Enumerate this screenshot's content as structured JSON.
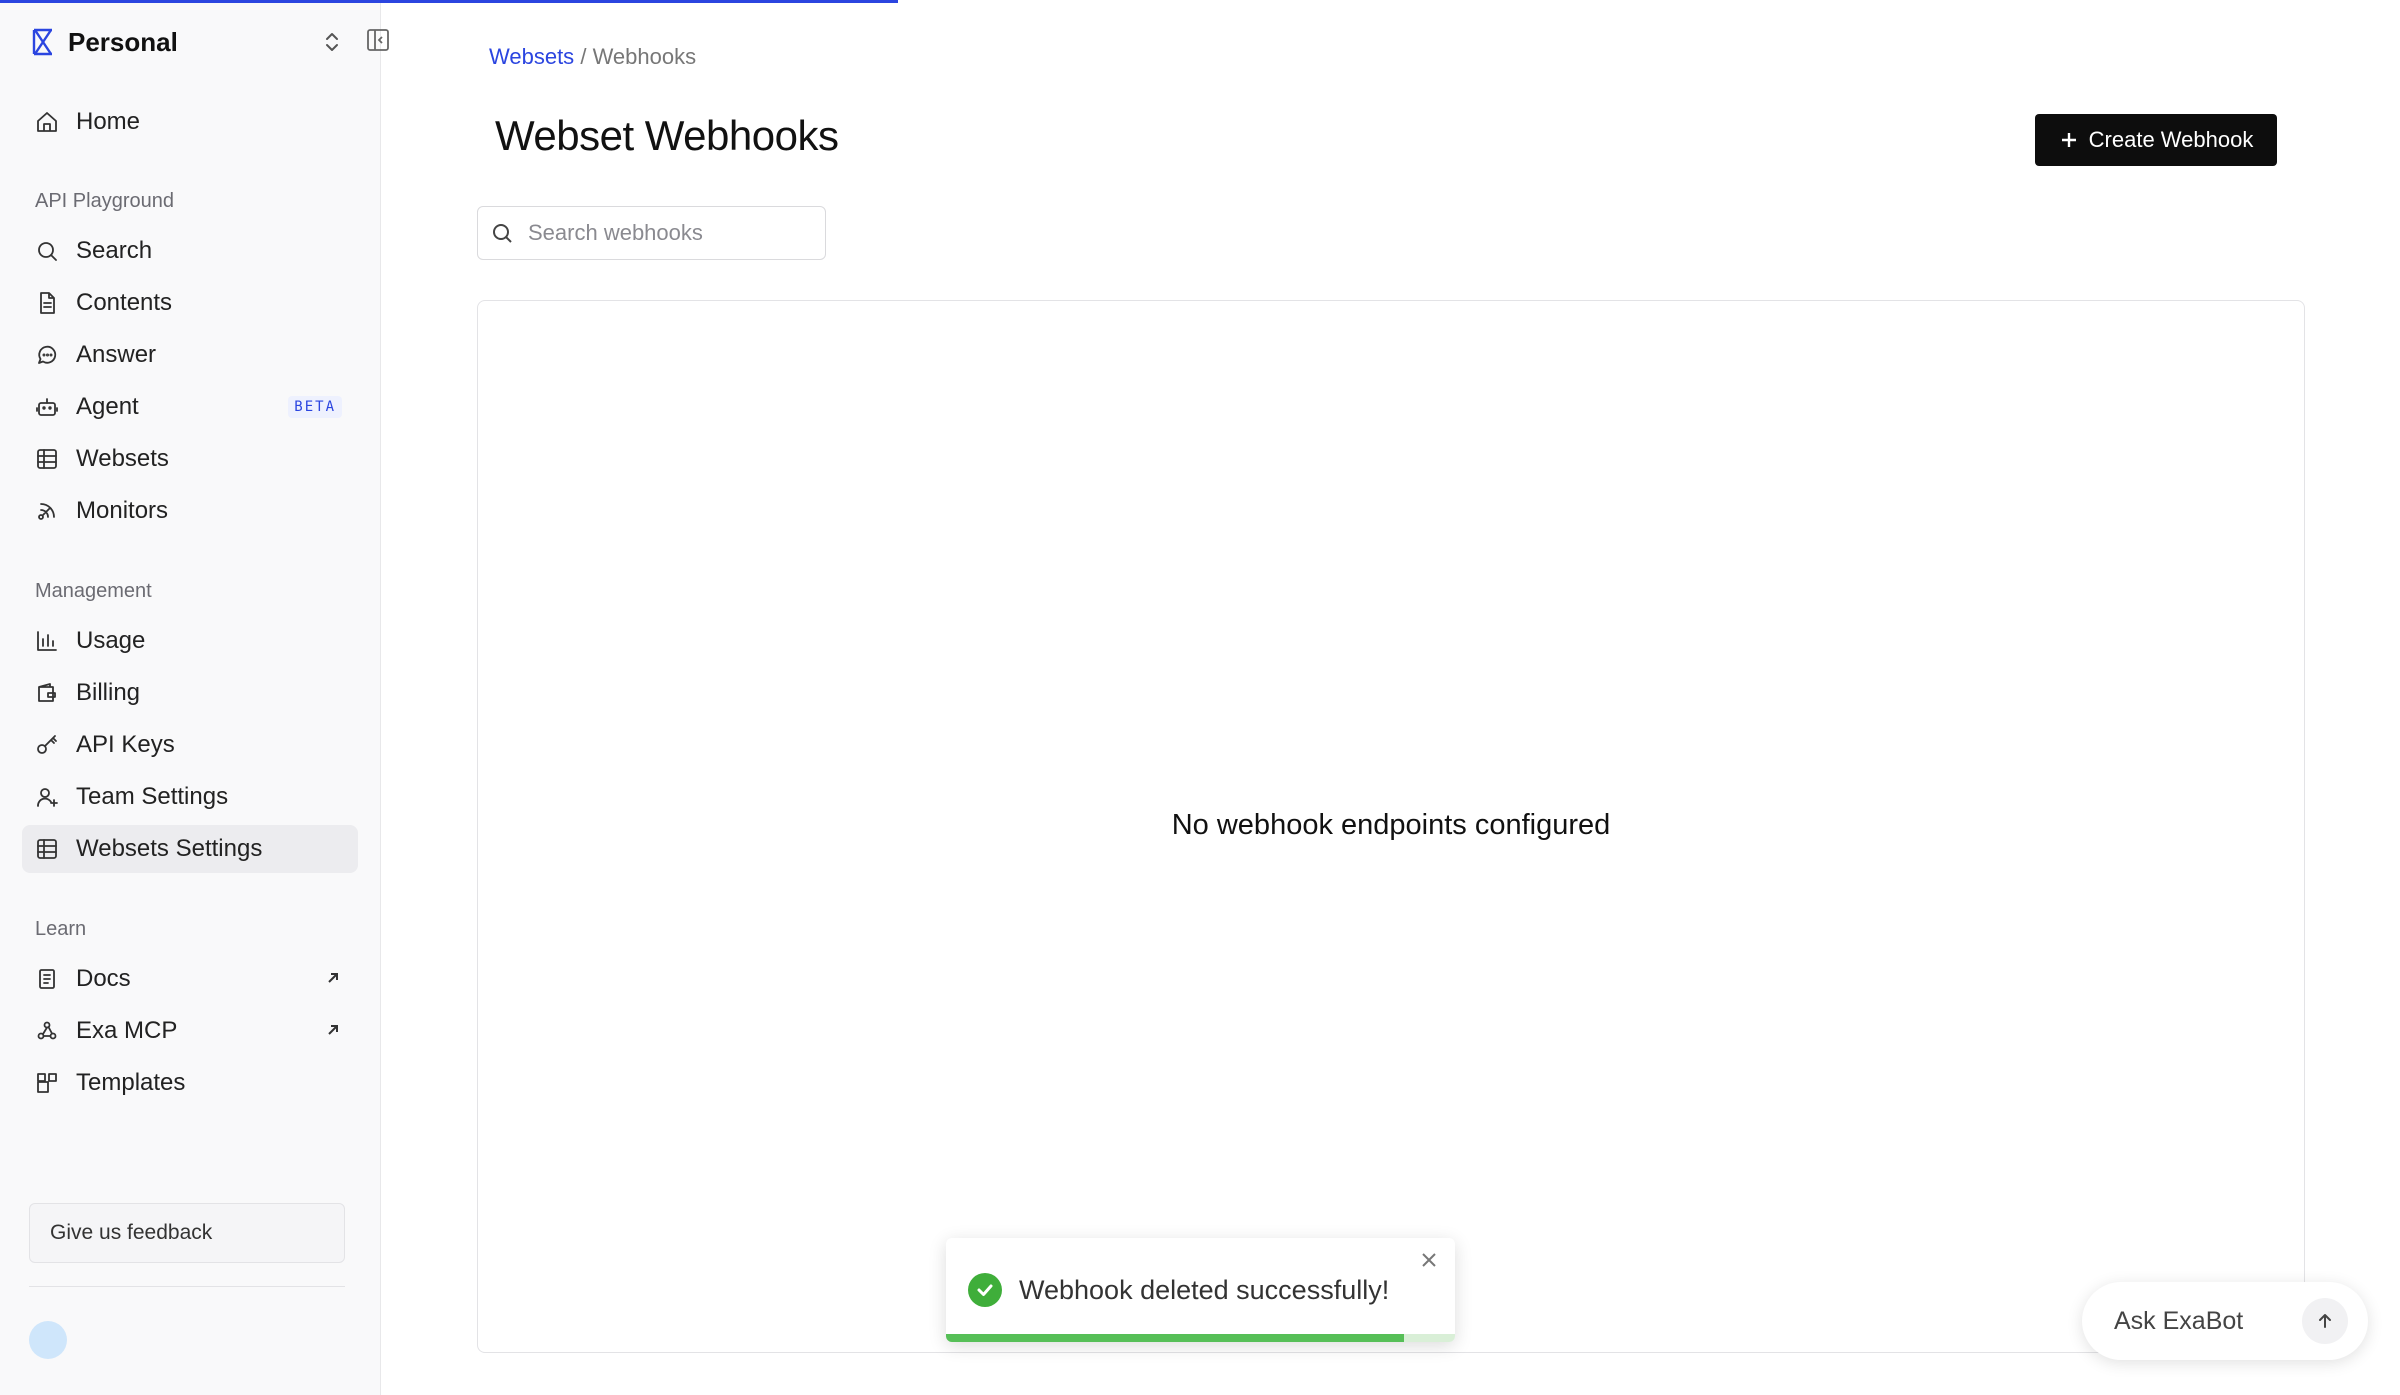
{
  "workspace": {
    "name": "Personal"
  },
  "sidebar": {
    "home_label": "Home",
    "sections": {
      "api_playground": "API Playground",
      "management": "Management",
      "learn": "Learn"
    },
    "items": {
      "search": "Search",
      "contents": "Contents",
      "answer": "Answer",
      "agent": "Agent",
      "agent_badge": "BETA",
      "websets": "Websets",
      "monitors": "Monitors",
      "usage": "Usage",
      "billing": "Billing",
      "api_keys": "API Keys",
      "team_settings": "Team Settings",
      "websets_settings": "Websets Settings",
      "docs": "Docs",
      "exa_mcp": "Exa MCP",
      "templates": "Templates"
    },
    "active_item": "Websets Settings",
    "feedback_label": "Give us feedback"
  },
  "breadcrumb": {
    "parent": "Websets",
    "separator": "/",
    "current": "Webhooks"
  },
  "page": {
    "title": "Webset Webhooks",
    "create_button": "Create Webhook",
    "search_placeholder": "Search webhooks",
    "empty_message": "No webhook endpoints configured"
  },
  "toast": {
    "message": "Webhook deleted successfully!",
    "progress": 0.9,
    "status_color": "#3fae3a"
  },
  "askbot": {
    "placeholder": "Ask ExaBot"
  },
  "colors": {
    "accent": "#2b45e0",
    "primary_button": "#0d0d0d"
  }
}
